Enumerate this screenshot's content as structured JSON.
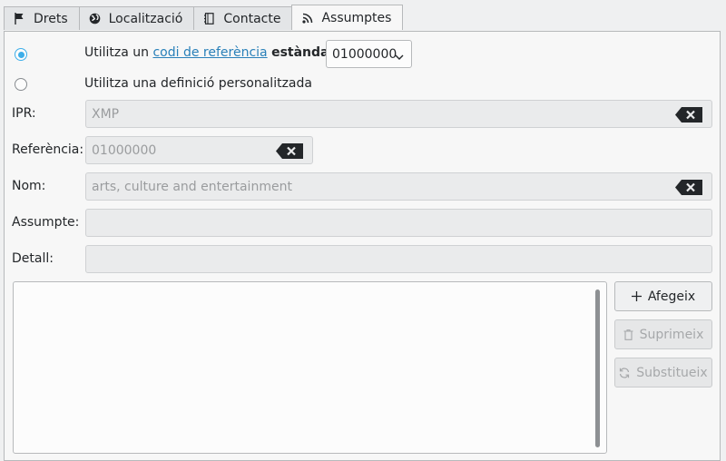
{
  "tabs": [
    {
      "label": "Drets",
      "icon": "flag-icon"
    },
    {
      "label": "Localització",
      "icon": "globe-icon"
    },
    {
      "label": "Contacte",
      "icon": "address-book-icon"
    },
    {
      "label": "Assumptes",
      "icon": "rss-icon",
      "active": true
    }
  ],
  "radio_standard": {
    "prefix": "Utilitza un",
    "link": "codi de referència",
    "suffix": "estàndard",
    "selected": true
  },
  "standard_code": {
    "value": "01000000"
  },
  "radio_custom": {
    "label": "Utilitza una definició personalitzada",
    "selected": false
  },
  "fields": {
    "ipr": {
      "label": "IPR:",
      "placeholder": "XMP"
    },
    "reference": {
      "label": "Referència:",
      "placeholder": "01000000"
    },
    "name": {
      "label": "Nom:",
      "placeholder": "arts, culture and entertainment"
    },
    "subject": {
      "label": "Assumpte:",
      "value": ""
    },
    "detail": {
      "label": "Detall:",
      "value": ""
    }
  },
  "buttons": {
    "add": "Afegeix",
    "remove": "Suprimeix",
    "replace": "Substitueix"
  },
  "colors": {
    "accent": "#3daee9",
    "link": "#2980b9"
  }
}
